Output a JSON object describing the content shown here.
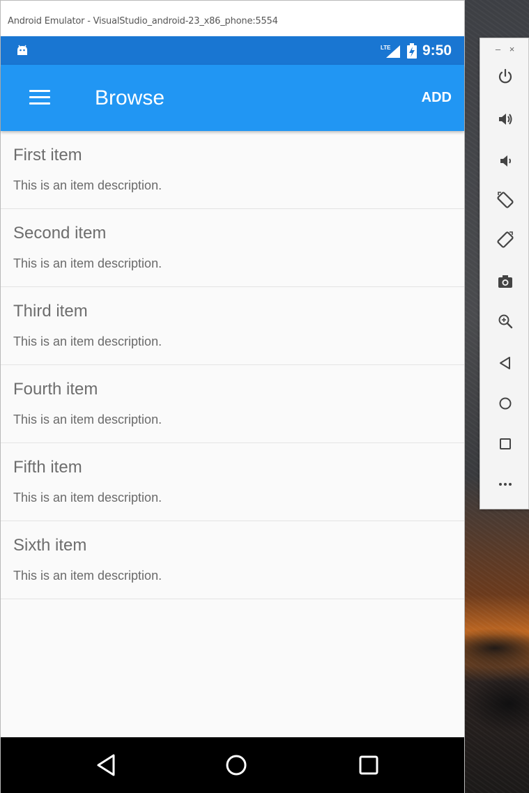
{
  "window": {
    "title": "Android Emulator - VisualStudio_android-23_x86_phone:5554"
  },
  "status_bar": {
    "time": "9:50",
    "network": "LTE",
    "icons": [
      "android-notification-icon",
      "lte-signal-icon",
      "battery-charging-icon"
    ]
  },
  "app_bar": {
    "title": "Browse",
    "add_label": "ADD",
    "menu_icon": "hamburger-menu-icon"
  },
  "items": [
    {
      "title": "First item",
      "description": "This is an item description."
    },
    {
      "title": "Second item",
      "description": "This is an item description."
    },
    {
      "title": "Third item",
      "description": "This is an item description."
    },
    {
      "title": "Fourth item",
      "description": "This is an item description."
    },
    {
      "title": "Fifth item",
      "description": "This is an item description."
    },
    {
      "title": "Sixth item",
      "description": "This is an item description."
    }
  ],
  "nav_bar": {
    "icons": [
      "back-icon",
      "home-icon",
      "recent-apps-icon"
    ]
  },
  "toolbar": {
    "minimize_label": "–",
    "close_label": "×",
    "icons": [
      "power-icon",
      "volume-up-icon",
      "volume-down-icon",
      "rotate-left-icon",
      "rotate-right-icon",
      "camera-icon",
      "zoom-icon",
      "back-icon",
      "home-icon",
      "overview-icon",
      "more-icon"
    ]
  },
  "colors": {
    "status_bar": "#1976d2",
    "app_bar": "#2196f3",
    "nav_bar": "#000000",
    "list_background": "#fafafa"
  }
}
